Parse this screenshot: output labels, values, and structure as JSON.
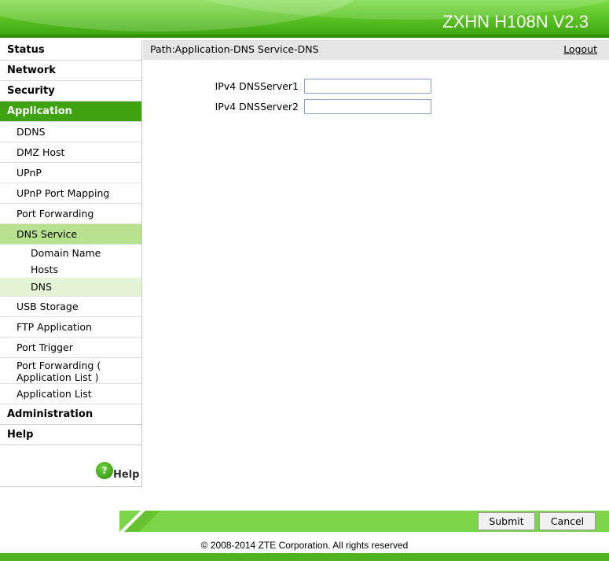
{
  "header": {
    "model": "ZXHN H108N V2.3"
  },
  "path": {
    "text": "Path:Application-DNS Service-DNS",
    "logout": "Logout"
  },
  "sidebar": {
    "status": "Status",
    "network": "Network",
    "security": "Security",
    "application": "Application",
    "app_items": {
      "ddns": "DDNS",
      "dmz": "DMZ Host",
      "upnp": "UPnP",
      "upnp_port": "UPnP Port Mapping",
      "port_forwarding": "Port Forwarding",
      "dns_service": "DNS Service",
      "domain_name": "Domain Name",
      "hosts": "Hosts",
      "dns": "DNS",
      "usb": "USB Storage",
      "ftp": "FTP Application",
      "port_trigger": "Port Trigger",
      "pf_app_line1": "Port Forwarding (",
      "pf_app_line2": "Application List )",
      "app_list": "Application List"
    },
    "administration": "Administration",
    "help": "Help",
    "help_link": "Help",
    "help_icon_glyph": "?"
  },
  "form": {
    "dns1_label": "IPv4 DNSServer1",
    "dns1_value": "",
    "dns2_label": "IPv4 DNSServer2",
    "dns2_value": ""
  },
  "buttons": {
    "submit": "Submit",
    "cancel": "Cancel"
  },
  "footer": {
    "copyright": "© 2008-2014 ZTE Corporation. All rights reserved"
  },
  "colors": {
    "brand_green": "#3ea30e",
    "selected_sub": "#b8e28f",
    "selected_sub3": "#e4f4d4",
    "bottom_bar": "#7dd64a"
  }
}
